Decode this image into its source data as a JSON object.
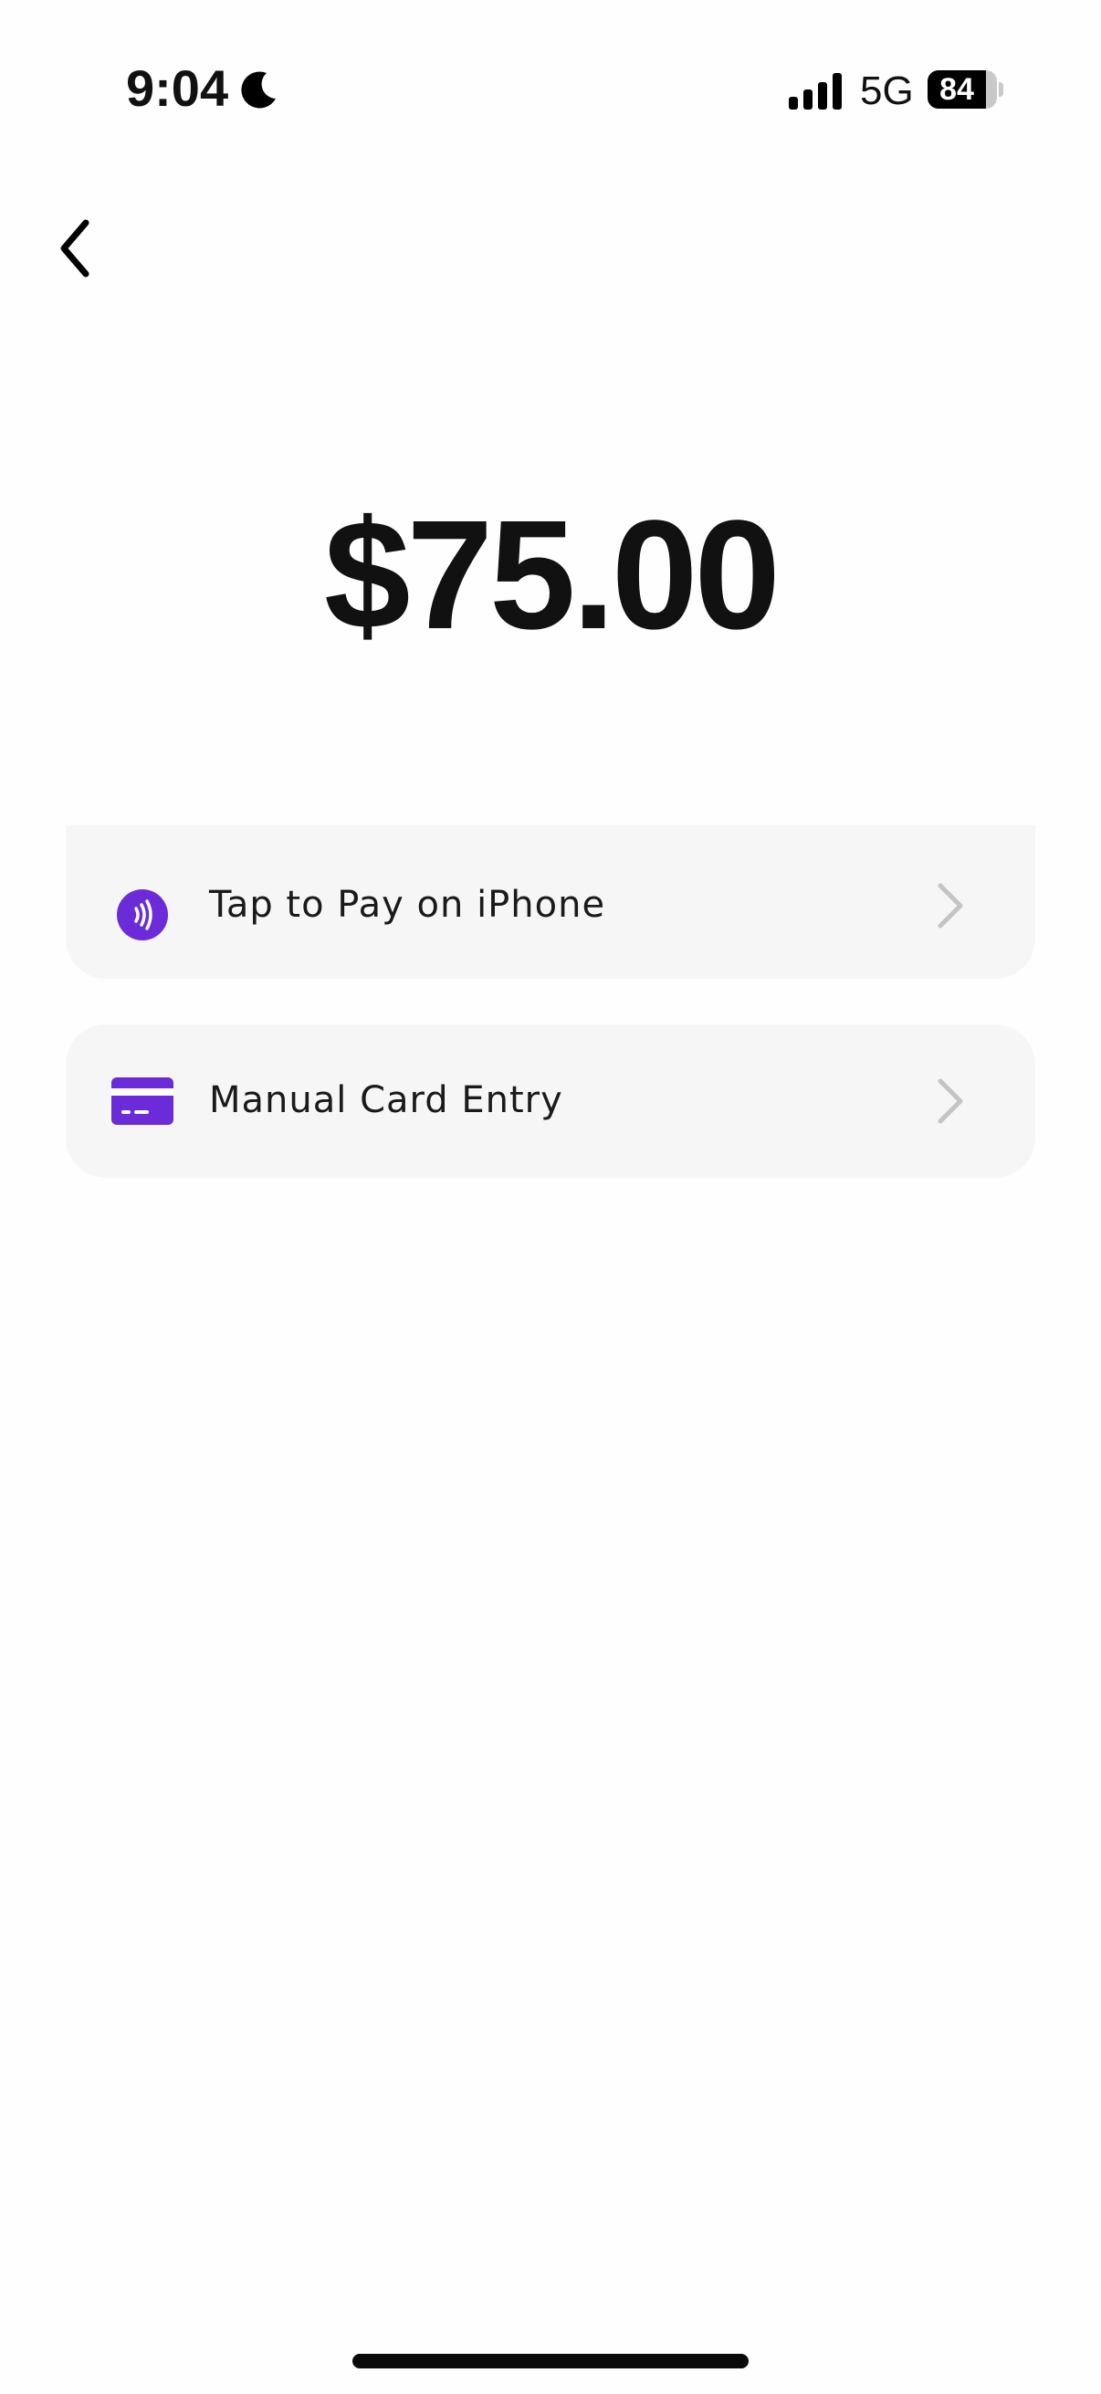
{
  "status_bar": {
    "time": "9:04",
    "network": "5G",
    "battery_percent": "84",
    "battery_level": 0.84
  },
  "payment": {
    "amount": "$75.00"
  },
  "options": [
    {
      "label": "Tap to Pay on iPhone",
      "icon": "contactless-icon"
    },
    {
      "label": "Manual Card Entry",
      "icon": "credit-card-icon"
    }
  ],
  "colors": {
    "accent": "#6c2bd9",
    "card_background": "#f6f6f6",
    "chevron": "#c4c4c4",
    "text": "#111111"
  }
}
